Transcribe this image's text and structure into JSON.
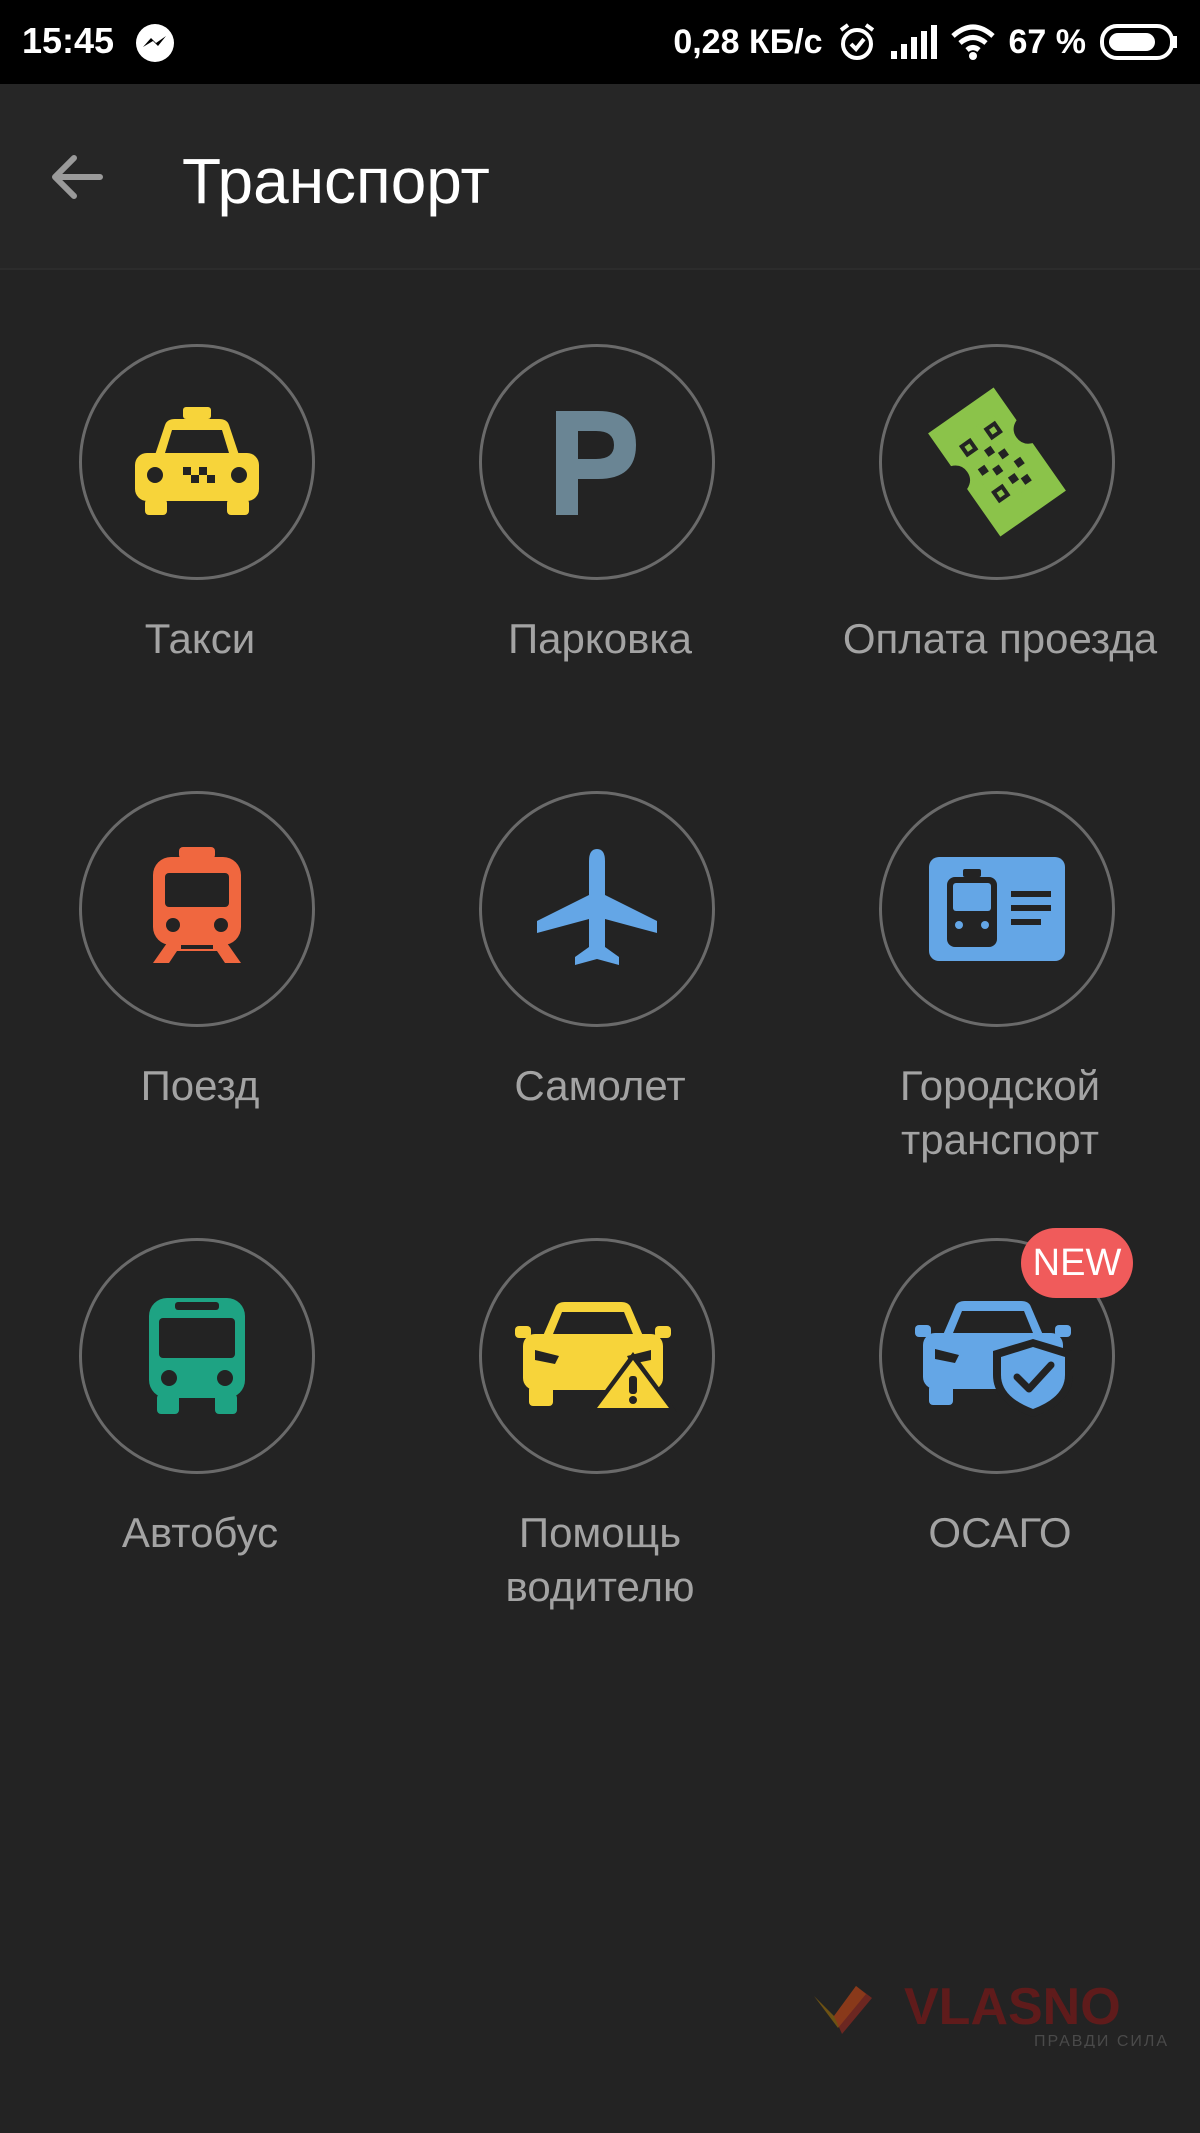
{
  "status_bar": {
    "time": "15:45",
    "speed": "0,28 КБ/с",
    "battery_percent": "67 %",
    "icons": [
      "messenger-icon",
      "alarm-icon",
      "signal-icon",
      "wifi-icon",
      "battery-icon"
    ]
  },
  "header": {
    "title": "Транспорт",
    "back_icon": "back-arrow-icon"
  },
  "tiles": [
    {
      "label": "Такси",
      "icon": "taxi-icon",
      "color": "#f7d43a"
    },
    {
      "label": "Парковка",
      "icon": "parking-icon",
      "color": "#6a8594"
    },
    {
      "label": "Оплата проезда",
      "icon": "ticket-qr-icon",
      "color": "#8bc34a"
    },
    {
      "label": "Поезд",
      "icon": "train-icon",
      "color": "#f0673f"
    },
    {
      "label": "Самолет",
      "icon": "airplane-icon",
      "color": "#64a6e6"
    },
    {
      "label": "Городской транспорт",
      "label_line1": "Городской",
      "label_line2": "транспорт",
      "icon": "transit-card-icon",
      "color": "#64a6e6"
    },
    {
      "label": "Автобус",
      "icon": "bus-icon",
      "color": "#1ea383"
    },
    {
      "label": "Помощь водителю",
      "label_line1": "Помощь",
      "label_line2": "водителю",
      "icon": "car-warning-icon",
      "color": "#f7d43a"
    },
    {
      "label": "ОСАГО",
      "icon": "car-insurance-icon",
      "color": "#64a6e6",
      "badge": "NEW"
    }
  ],
  "watermark": {
    "brand": "VLASNO",
    "tagline": "ПРАВДИ СИЛА"
  }
}
